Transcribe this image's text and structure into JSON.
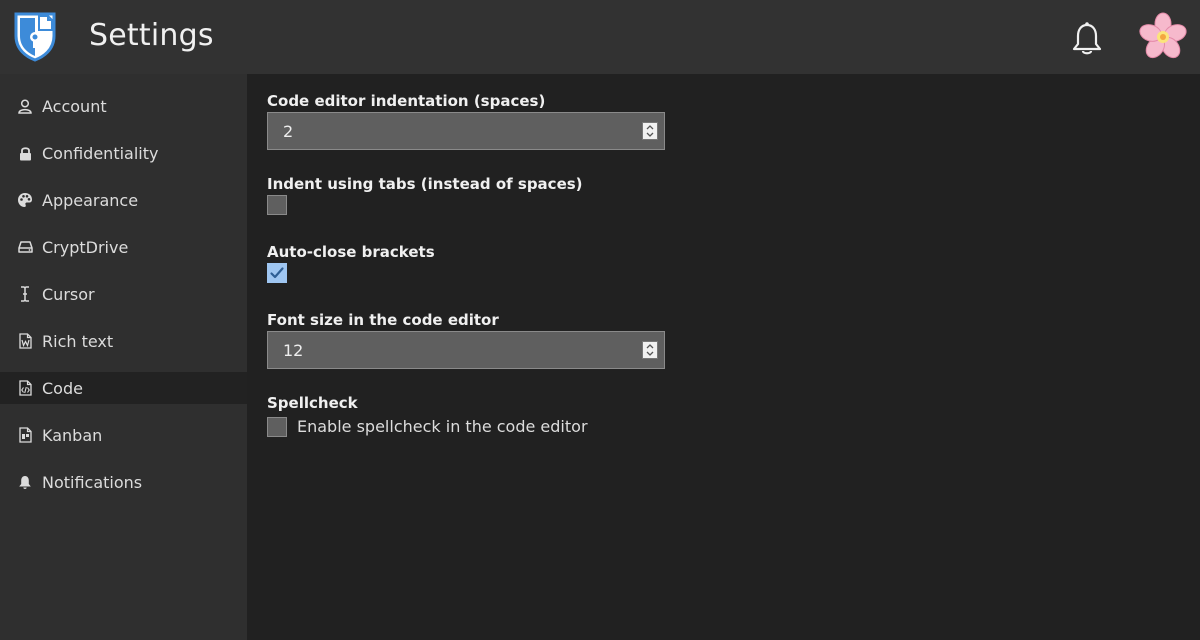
{
  "header": {
    "title": "Settings"
  },
  "sidebar": {
    "items": [
      {
        "label": "Account",
        "icon": "user-icon",
        "active": false
      },
      {
        "label": "Confidentiality",
        "icon": "lock-icon",
        "active": false
      },
      {
        "label": "Appearance",
        "icon": "palette-icon",
        "active": false
      },
      {
        "label": "CryptDrive",
        "icon": "drive-icon",
        "active": false
      },
      {
        "label": "Cursor",
        "icon": "text-cursor-icon",
        "active": false
      },
      {
        "label": "Rich text",
        "icon": "rich-text-file-icon",
        "active": false
      },
      {
        "label": "Code",
        "icon": "code-file-icon",
        "active": true
      },
      {
        "label": "Kanban",
        "icon": "kanban-file-icon",
        "active": false
      },
      {
        "label": "Notifications",
        "icon": "bell-icon",
        "active": false
      }
    ]
  },
  "main": {
    "indentation": {
      "label": "Code editor indentation (spaces)",
      "value": "2"
    },
    "tabs": {
      "label": "Indent using tabs (instead of spaces)",
      "checked": false
    },
    "brackets": {
      "label": "Auto-close brackets",
      "checked": true
    },
    "font_size": {
      "label": "Font size in the code editor",
      "value": "12"
    },
    "spellcheck": {
      "label": "Spellcheck",
      "checkbox_label": "Enable spellcheck in the code editor",
      "checked": false
    }
  },
  "colors": {
    "header_bg": "#323232",
    "sidebar_bg": "#2f2f2f",
    "content_bg": "#212121",
    "accent_check": "#9fc6f1",
    "logo_blue": "#3d8bd9"
  }
}
